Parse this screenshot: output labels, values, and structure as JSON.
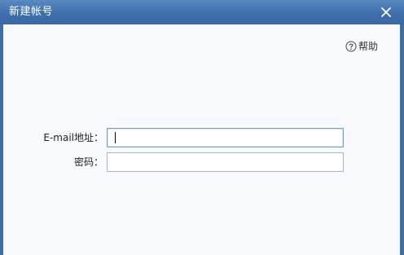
{
  "dialog": {
    "title": "新建帐号",
    "close_icon": "close-icon"
  },
  "help": {
    "icon": "question-circle-icon",
    "label": "帮助"
  },
  "form": {
    "email": {
      "label": "E-mail地址：",
      "value": "",
      "placeholder": ""
    },
    "password": {
      "label": "密码：",
      "value": "",
      "placeholder": ""
    }
  },
  "colors": {
    "titlebar": "#3f70ad",
    "content_bg": "#f7f9fd",
    "input_border": "#aab4c2",
    "focused_border": "#7b9ebd"
  }
}
